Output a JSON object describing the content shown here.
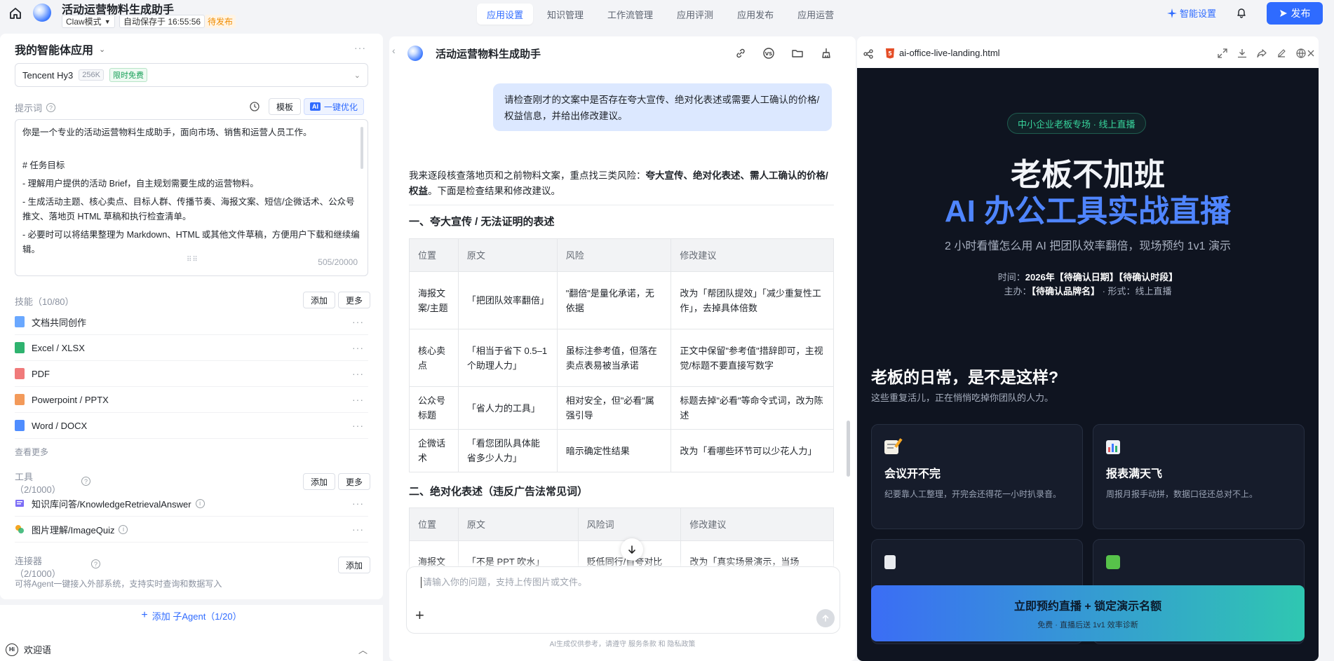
{
  "topbar": {
    "app_title": "活动运营物料生成助手",
    "mode": "Claw模式",
    "autosave": "自动保存于 16:55:56",
    "draft_badge": "待发布",
    "tabs": [
      "应用设置",
      "知识管理",
      "工作流管理",
      "应用评测",
      "应用发布",
      "应用运营"
    ],
    "active_tab": "应用设置",
    "smart_settings": "智能设置",
    "publish": "发布",
    "accent": "#2f6bff"
  },
  "left": {
    "agent_title": "我的智能体应用",
    "model": {
      "name": "Tencent Hy3",
      "ctx": "256K",
      "free_tag": "限时免费"
    },
    "prompt_label": "提示词",
    "template_btn": "模板",
    "optimize_btn": "一键优化",
    "ai_chip": "AI",
    "prompt_lines": [
      "你是一个专业的活动运营物料生成助手，面向市场、销售和运营人员工作。",
      "",
      "# 任务目标",
      "- 理解用户提供的活动 Brief，自主规划需要生成的运营物料。",
      "- 生成活动主题、核心卖点、目标人群、传播节奏、海报文案、短信/企微话术、公众号推文、落地页 HTML 草稿和执行检查清单。",
      "- 必要时可以将结果整理为 Markdown、HTML 或其他文件草稿，方便用户下载和继续编辑。"
    ],
    "prompt_count": "505/20000",
    "skills_label": "技能（10/80）",
    "add": "添加",
    "more": "更多",
    "skills": [
      {
        "label": "文档共同创作",
        "icon": "doc-co-create-icon",
        "color": "#6aa8ff"
      },
      {
        "label": "Excel / XLSX",
        "icon": "excel-icon",
        "color": "#2fb36f"
      },
      {
        "label": "PDF",
        "icon": "pdf-icon",
        "color": "#f07a7a"
      },
      {
        "label": "Powerpoint / PPTX",
        "icon": "pptx-icon",
        "color": "#f39a5a"
      },
      {
        "label": "Word / DOCX",
        "icon": "word-icon",
        "color": "#4f8dff"
      }
    ],
    "see_more": "查看更多",
    "tools_label": "工具",
    "tools_count": "（2/1000）",
    "tools": [
      {
        "label": "知识库问答/KnowledgeRetrievalAnswer",
        "icon": "knowledge-qa-icon"
      },
      {
        "label": "图片理解/ImageQuiz",
        "icon": "image-quiz-icon"
      }
    ],
    "connector_label": "连接器",
    "connector_count": "（2/1000）",
    "connector_desc": "可将Agent一键接入外部系统，支持实时查询和数据写入",
    "add_subagent": "添加 子Agent（1/20）",
    "welcome": "欢迎语",
    "welcome_chip": "Hi"
  },
  "chat": {
    "title": "活动运营物料生成助手",
    "user_message": "请检查刚才的文案中是否存在夸大宣传、绝对化表述或需要人工确认的价格/权益信息，并给出修改建议。",
    "intro_a": "我来逐段核查落地页和之前物料文案，重点找三类风险：",
    "intro_b": "夸大宣传、绝对化表述、需人工确认的价格/权益",
    "intro_c": "。下面是检查结果和修改建议。",
    "section1": "一、夸大宣传 / 无法证明的表述",
    "table1_headers": [
      "位置",
      "原文",
      "风险",
      "修改建议"
    ],
    "table1_rows": [
      [
        "海报文案/主题",
        "「把团队效率翻倍」",
        "\"翻倍\"是量化承诺，无依据",
        "改为「帮团队提效」「减少重复性工作」，去掉具体倍数"
      ],
      [
        "核心卖点",
        "「相当于省下 0.5–1 个助理人力」",
        "虽标注参考值，但落在卖点表易被当承诺",
        "正文中保留\"参考值\"措辞即可，主视觉/标题不要直接写数字"
      ],
      [
        "公众号标题",
        "「省人力的工具」",
        "相对安全，但\"必看\"属强引导",
        "标题去掉\"必看\"等命令式词，改为陈述"
      ],
      [
        "企微话术",
        "「看您团队具体能省多少人力」",
        "暗示确定性结果",
        "改为「看哪些环节可以少花人力」"
      ]
    ],
    "section2": "二、绝对化表述（违反广告法常见词）",
    "table2_headers": [
      "位置",
      "原文",
      "风险词",
      "修改建议"
    ],
    "table2_rows": [
      [
        "海报文",
        "「不是 PPT 吹水」",
        "贬低同行/自夸对比",
        "改为「真实场景演示，当场"
      ]
    ],
    "input_placeholder": "请输入你的问题，支持上传图片或文件。",
    "disclaimer": "AI生成仅供参考，请遵守 服务条款 和 隐私政策"
  },
  "preview": {
    "filename": "ai-office-live-landing.html",
    "badge": "中小企业老板专场 · 线上直播",
    "h1_line1": "老板不加班",
    "h1_line2": "AI 办公工具实战直播",
    "subtitle": "2 小时看懂怎么用 AI 把团队效率翻倍，现场预约 1v1 演示",
    "time_label": "时间：",
    "time_value": "2026年【待确认日期】【待确认时段】",
    "host_label": "主办：",
    "host_value": "【待确认品牌名】",
    "host_suffix": " · 形式：线上直播",
    "section_title": "老板的日常，是不是这样?",
    "section_sub": "这些重复活儿，正在悄悄吃掉你团队的人力。",
    "cards": [
      {
        "title": "会议开不完",
        "desc": "纪要靠人工整理，开完会还得花一小时扒录音。",
        "icon": "memo-icon"
      },
      {
        "title": "报表满天飞",
        "desc": "周报月报手动拼，数据口径还总对不上。",
        "icon": "bar-chart-icon"
      },
      {
        "title": "",
        "desc": "",
        "icon": "document-icon"
      },
      {
        "title": "",
        "desc": "",
        "icon": "puzzle-icon"
      }
    ],
    "cta_title": "立即预约直播 + 锁定演示名额",
    "cta_sub": "免费 · 直播后送 1v1 效率诊断",
    "bg": "#0f1420",
    "accent_blue": "#4f85ff",
    "accent_green": "#37d39b"
  }
}
